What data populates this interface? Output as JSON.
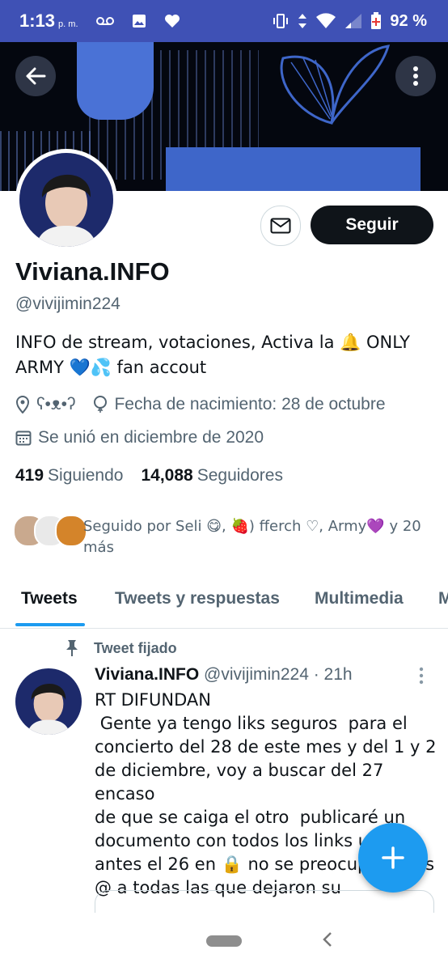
{
  "status_bar": {
    "time": "1:13",
    "ampm": "p. m.",
    "battery": "92 %"
  },
  "profile": {
    "name": "Viviana.INFO",
    "handle": "@vivijimin224",
    "bio_line1": "INFO de stream, votaciones, Activa la 🔔 ONLY",
    "bio_line2": "ARMY 💙💦  fan accout",
    "location": "ʕ•ᴥ•ʔ",
    "birthday": "Fecha de nacimiento: 28 de octubre",
    "joined": "Se unió en diciembre de 2020",
    "following_count": "419",
    "following_label": "Siguiendo",
    "followers_count": "14,088",
    "followers_label": "Seguidores",
    "followed_by": "Seguido por Seli 😋, 🍓) fferch ♡, Army💜 y 20 más",
    "follow_label": "Seguir"
  },
  "tabs": [
    {
      "label": "Tweets",
      "active": true
    },
    {
      "label": "Tweets y respuestas",
      "active": false
    },
    {
      "label": "Multimedia",
      "active": false
    },
    {
      "label": "M",
      "active": false
    }
  ],
  "tweet": {
    "pinned_label": "Tweet fijado",
    "author": "Viviana.INFO",
    "handle_time": "@vivijimin224 · 21h",
    "body": "RT DIFUNDAN\n Gente ya tengo liks seguros  para el\nconcierto del 28 de este mes y del 1 y 2\nde diciembre, voy a buscar del 27 encaso\nde que se caiga el otro  publicaré un\ndocumento con todos los links un día\nantes el 26 en 🔒 no se preocupen y les\n@ a todas las que dejaron su"
  },
  "colors": {
    "status_bar": "#3f51b5",
    "accent": "#1d9bf0",
    "text_primary": "#0f1419",
    "text_secondary": "#536471"
  }
}
